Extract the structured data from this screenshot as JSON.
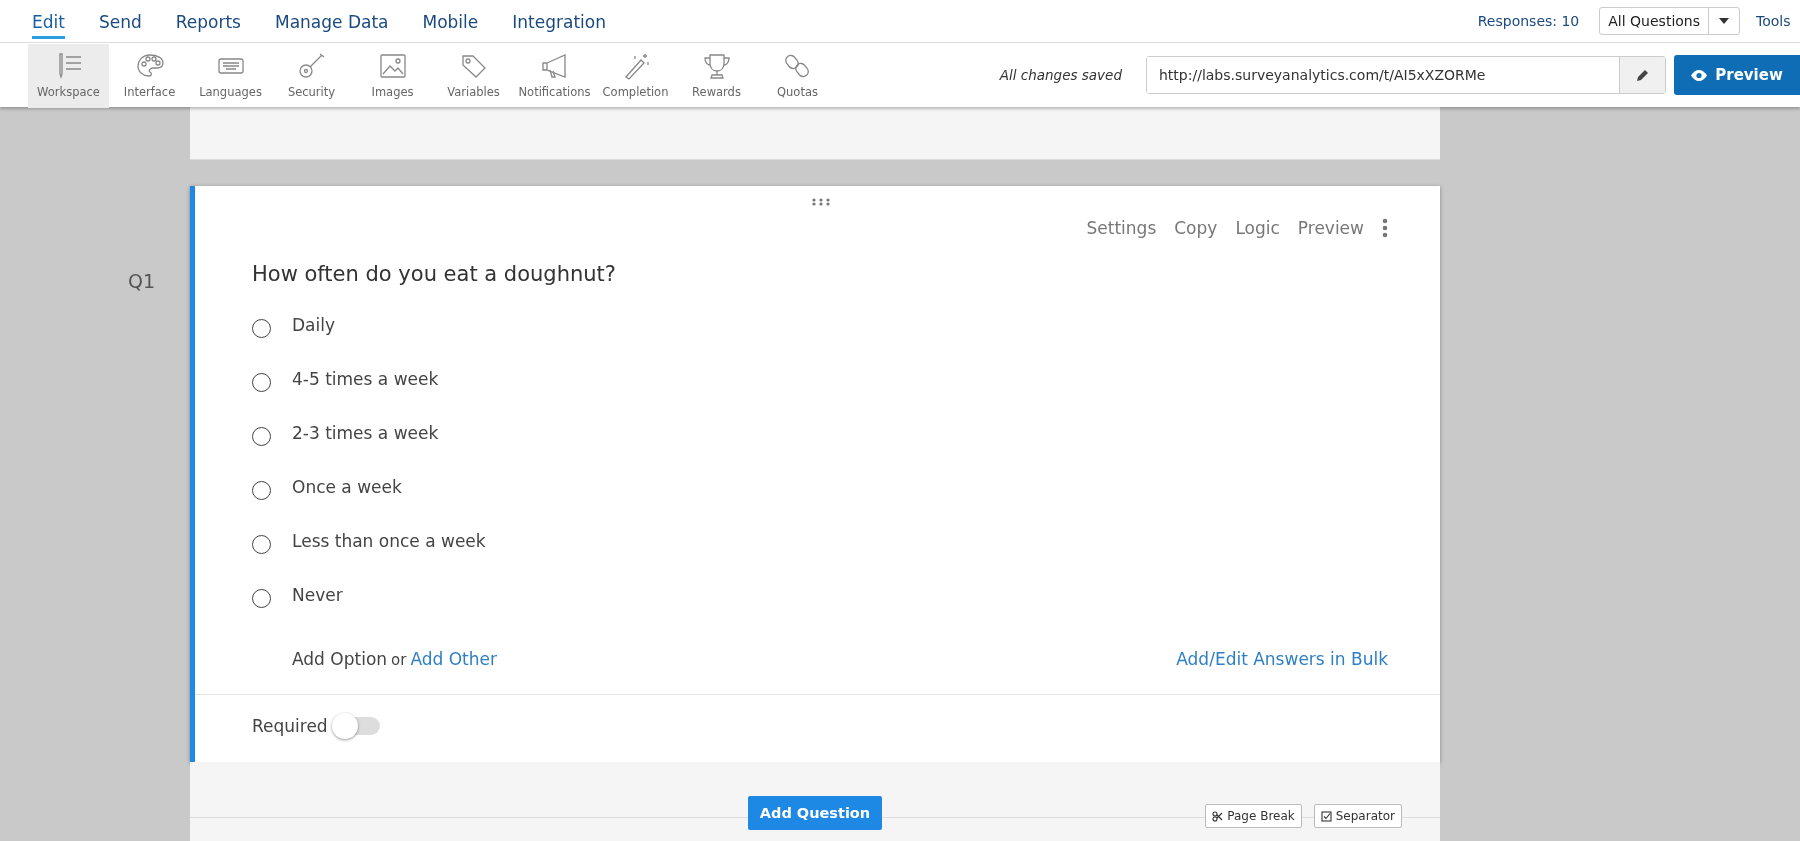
{
  "nav": {
    "tabs": [
      {
        "label": "Edit",
        "selected": true
      },
      {
        "label": "Send",
        "selected": false
      },
      {
        "label": "Reports",
        "selected": false
      },
      {
        "label": "Manage Data",
        "selected": false
      },
      {
        "label": "Mobile",
        "selected": false
      },
      {
        "label": "Integration",
        "selected": false
      }
    ],
    "responses": "Responses: 10",
    "filter": {
      "value": "All Questions"
    },
    "tools": "Tools"
  },
  "toolbar": {
    "items": [
      {
        "label": "Workspace",
        "selected": true
      },
      {
        "label": "Interface",
        "selected": false
      },
      {
        "label": "Languages",
        "selected": false
      },
      {
        "label": "Security",
        "selected": false
      },
      {
        "label": "Images",
        "selected": false
      },
      {
        "label": "Variables",
        "selected": false
      },
      {
        "label": "Notifications",
        "selected": false
      },
      {
        "label": "Completion",
        "selected": false
      },
      {
        "label": "Rewards",
        "selected": false
      },
      {
        "label": "Quotas",
        "selected": false
      }
    ],
    "save_status": "All changes saved",
    "url": "http://labs.surveyanalytics.com/t/AI5xXZORMe",
    "preview": "Preview"
  },
  "question": {
    "number": "Q1",
    "actions": [
      "Settings",
      "Copy",
      "Logic",
      "Preview"
    ],
    "text": "How often do you eat a doughnut?",
    "options": [
      {
        "label": "Daily",
        "selected": false
      },
      {
        "label": "4-5 times a week",
        "selected": false
      },
      {
        "label": "2-3 times a week",
        "selected": false
      },
      {
        "label": "Once a week",
        "selected": false
      },
      {
        "label": "Less than once a week",
        "selected": false
      },
      {
        "label": "Never",
        "selected": false
      }
    ],
    "add_option": "Add Option",
    "or": "or",
    "add_other": "Add Other",
    "bulk": "Add/Edit Answers in Bulk",
    "required": {
      "label": "Required",
      "on": false
    }
  },
  "footer": {
    "add_question": "Add Question",
    "page_break": "Page Break",
    "separator": "Separator"
  }
}
